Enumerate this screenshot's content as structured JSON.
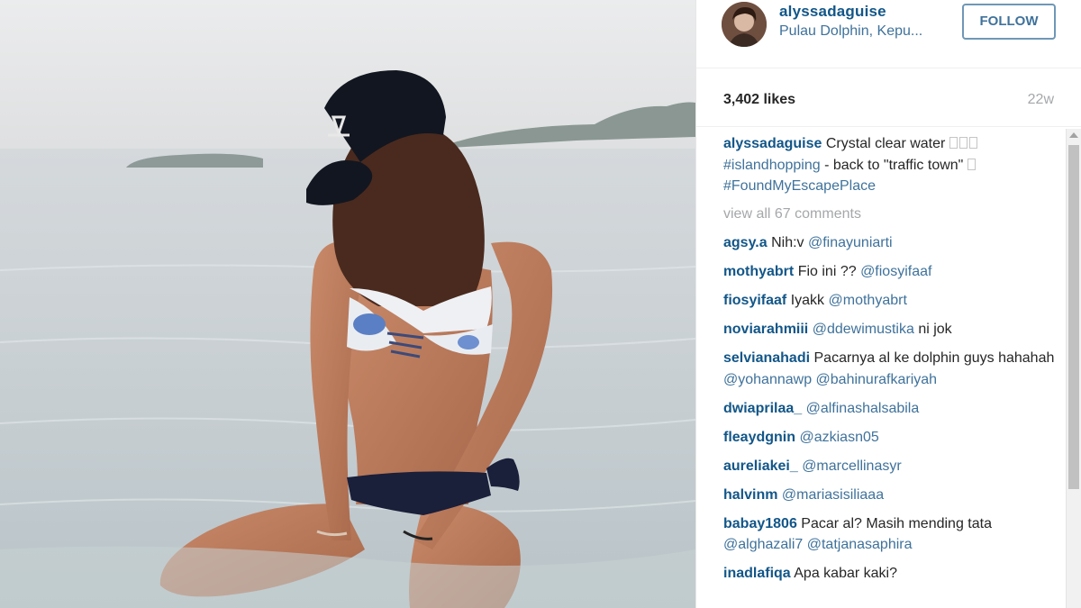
{
  "post": {
    "username": "alyssadaguise",
    "location": "Pulau Dolphin, Kepu...",
    "follow_label": "FOLLOW",
    "likes": "3,402 likes",
    "age": "22w"
  },
  "caption": {
    "user": "alyssadaguise",
    "text1": "Crystal clear water",
    "hashtag1": "#islandhopping",
    "text2": "- back to \"traffic town\"",
    "hashtag2": "#FoundMyEscapePlace"
  },
  "view_all": "view all 67 comments",
  "comments": [
    {
      "user": "agsy.a",
      "text": "Nih:v",
      "mentions": "@finayuniarti"
    },
    {
      "user": "mothyabrt",
      "text": "Fio ini ??",
      "mentions": "@fiosyifaaf"
    },
    {
      "user": "fiosyifaaf",
      "text": "Iyakk",
      "mentions": "@mothyabrt"
    },
    {
      "user": "noviarahmiii",
      "text": "",
      "mentions": "@ddewimustika",
      "after": "ni jok"
    },
    {
      "user": "selvianahadi",
      "text": "Pacarnya al ke dolphin guys hahahah",
      "mentions": "@yohannawp @bahinurafkariyah"
    },
    {
      "user": "dwiaprilaa_",
      "text": "",
      "mentions": "@alfinashalsabila"
    },
    {
      "user": "fleaydgnin",
      "text": "",
      "mentions": "@azkiasn05"
    },
    {
      "user": "aureliakei_",
      "text": "",
      "mentions": "@marcellinasyr"
    },
    {
      "user": "halvinm",
      "text": "",
      "mentions": "@mariasisiliaaa"
    },
    {
      "user": "babay1806",
      "text": "Pacar al? Masih mending tata",
      "mentions": "@alghazali7 @tatjanasaphira"
    },
    {
      "user": "inadlafiqa",
      "text": "Apa kabar kaki?",
      "mentions": ""
    }
  ],
  "colors": {
    "username_blue": "#125688",
    "link_blue": "#3f729b",
    "muted_gray": "#a5a7aa",
    "follow_border": "#6f97b6"
  }
}
